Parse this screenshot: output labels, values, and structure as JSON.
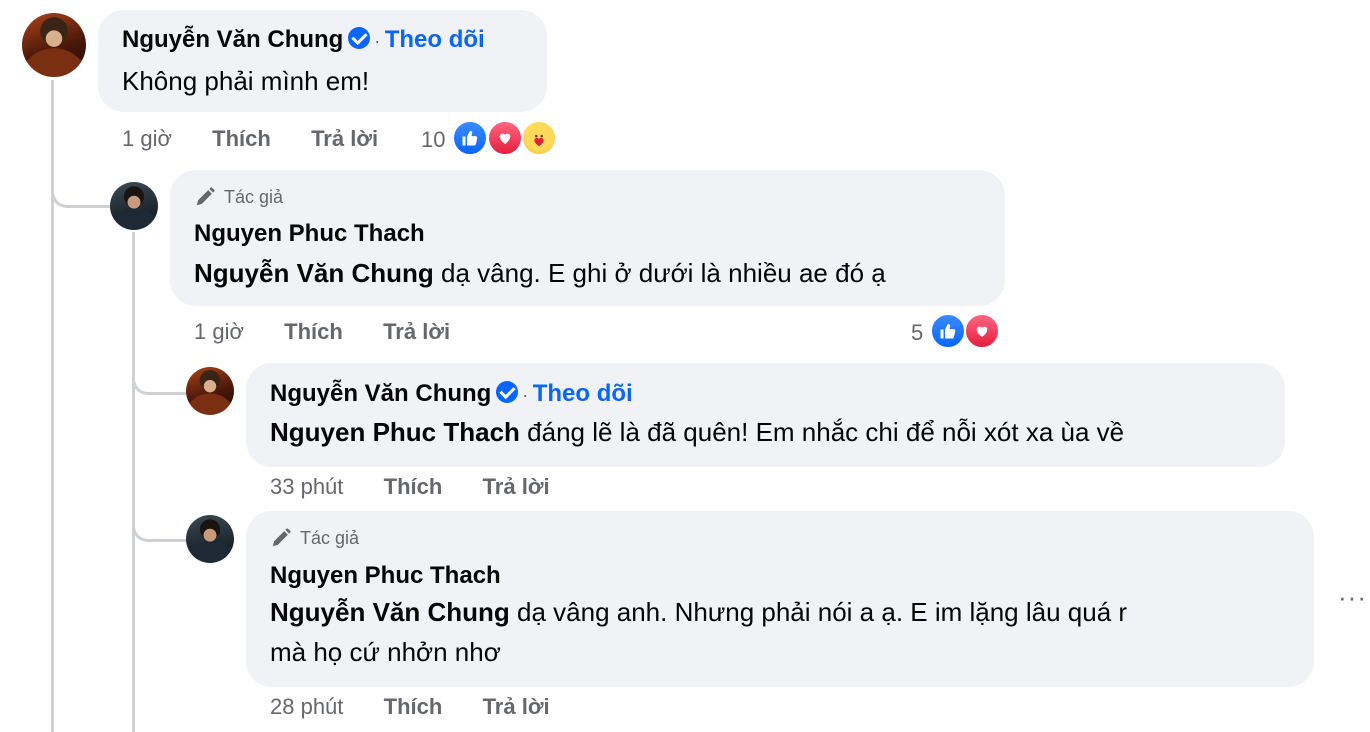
{
  "comments": [
    {
      "author": "Nguyễn Văn Chung",
      "follow": "Theo dõi",
      "separator": "·",
      "text": "Không phải mình em!",
      "time": "1 giờ",
      "like": "Thích",
      "reply": "Trả lời",
      "reaction_count": "10",
      "reactions": [
        "like-icon",
        "love-icon",
        "care-icon"
      ]
    },
    {
      "author_tag": "Tác giả",
      "author": "Nguyen Phuc Thach",
      "mention": "Nguyễn Văn Chung",
      "text": "dạ vâng. E ghi ở dưới là nhiều ae đó ạ",
      "time": "1 giờ",
      "like": "Thích",
      "reply": "Trả lời",
      "reaction_count": "5",
      "reactions": [
        "like-icon",
        "love-icon"
      ]
    },
    {
      "author": "Nguyễn Văn Chung",
      "follow": "Theo dõi",
      "separator": "·",
      "mention": "Nguyen Phuc Thach",
      "text": "đáng lẽ là đã quên! Em nhắc chi để nỗi xót xa ùa về",
      "time": "33 phút",
      "like": "Thích",
      "reply": "Trả lời"
    },
    {
      "author_tag": "Tác giả",
      "author": "Nguyen Phuc Thach",
      "mention": "Nguyễn Văn Chung",
      "text_line1": "dạ vâng anh. Nhưng phải nói a ạ. E im lặng lâu quá r",
      "text_line2": "mà họ cứ nhởn nhơ",
      "time": "28 phút",
      "like": "Thích",
      "reply": "Trả lời",
      "more": "···"
    }
  ],
  "colors": {
    "accent": "#0866ff",
    "bubble": "#f0f2f5",
    "muted": "#65676b",
    "line": "#ced0d4"
  }
}
